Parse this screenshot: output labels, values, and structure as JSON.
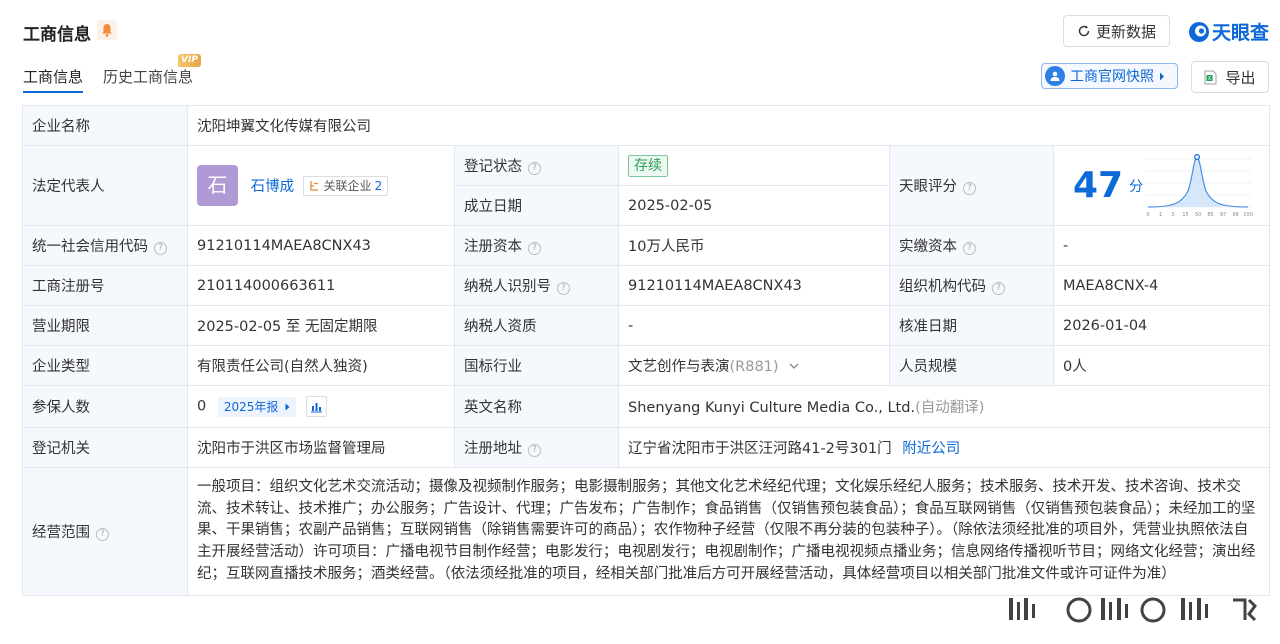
{
  "header": {
    "title": "工商信息",
    "update_label": "更新数据",
    "logo_text": "天眼查"
  },
  "tabs": [
    {
      "label": "工商信息"
    },
    {
      "label": "历史工商信息",
      "badge": "VIP"
    }
  ],
  "actions": {
    "snapshot_label": "工商官网快照",
    "export_label": "导出"
  },
  "company": {
    "name_label": "企业名称",
    "name": "沈阳坤翼文化传媒有限公司",
    "rep_label": "法定代表人",
    "rep_avatar": "石",
    "rep_name": "石博成",
    "rep_related_label": "关联企业",
    "rep_related_count": "2",
    "status_label": "登记状态",
    "status": "存续",
    "established_label": "成立日期",
    "established": "2025-02-05",
    "score_label": "天眼评分",
    "score": "47",
    "score_unit": "分",
    "score_axis": [
      "0",
      "1",
      "3",
      "15",
      "50",
      "85",
      "97",
      "99",
      "100"
    ],
    "credit_code_label": "统一社会信用代码",
    "credit_code": "91210114MAEA8CNX43",
    "reg_capital_label": "注册资本",
    "reg_capital": "10万人民币",
    "paid_capital_label": "实缴资本",
    "paid_capital": "-",
    "reg_no_label": "工商注册号",
    "reg_no": "210114000663611",
    "taxpayer_id_label": "纳税人识别号",
    "taxpayer_id": "91210114MAEA8CNX43",
    "org_code_label": "组织机构代码",
    "org_code": "MAEA8CNX-4",
    "term_label": "营业期限",
    "term": "2025-02-05 至 无固定期限",
    "taxpayer_qual_label": "纳税人资质",
    "taxpayer_qual": "-",
    "approval_date_label": "核准日期",
    "approval_date": "2026-01-04",
    "type_label": "企业类型",
    "type": "有限责任公司(自然人独资)",
    "industry_label": "国标行业",
    "industry": "文艺创作与表演",
    "industry_code": "(R881)",
    "staff_size_label": "人员规模",
    "staff_size": "0人",
    "insured_label": "参保人数",
    "insured": "0",
    "insured_report": "2025年报",
    "english_name_label": "英文名称",
    "english_name": "Shenyang Kunyi Culture Media Co., Ltd.",
    "english_name_note": "(自动翻译)",
    "authority_label": "登记机关",
    "authority": "沈阳市于洪区市场监督管理局",
    "address_label": "注册地址",
    "address": "辽宁省沈阳市于洪区汪河路41-2号301门",
    "nearby_label": "附近公司",
    "scope_label": "经营范围",
    "scope": "一般项目：组织文化艺术交流活动；摄像及视频制作服务；电影摄制服务；其他文化艺术经纪代理；文化娱乐经纪人服务；技术服务、技术开发、技术咨询、技术交流、技术转让、技术推广；办公服务；广告设计、代理；广告发布；广告制作；食品销售（仅销售预包装食品）；食品互联网销售（仅销售预包装食品）；未经加工的坚果、干果销售；农副产品销售；互联网销售（除销售需要许可的商品）；农作物种子经营（仅限不再分装的包装种子）。（除依法须经批准的项目外，凭营业执照依法自主开展经营活动）许可项目：广播电视节目制作经营；电影发行；电视剧发行；电视剧制作；广播电视视频点播业务；信息网络传播视听节目；网络文化经营；演出经纪；互联网直播技术服务；酒类经营。（依法须经批准的项目，经相关部门批准后方可开展经营活动，具体经营项目以相关部门批准文件或许可证件为准）"
  },
  "colors": {
    "accent": "#0d69d8",
    "label_bg": "#f5f8fc",
    "status_green": "#2e9e5b",
    "avatar": "#b09ad6"
  },
  "icons": [
    "bell-icon",
    "refresh-icon",
    "tianyancha-logo-icon",
    "info-icon",
    "excel-icon",
    "chevron-down-icon",
    "bar-chart-icon",
    "help-icon",
    "link-icon"
  ]
}
